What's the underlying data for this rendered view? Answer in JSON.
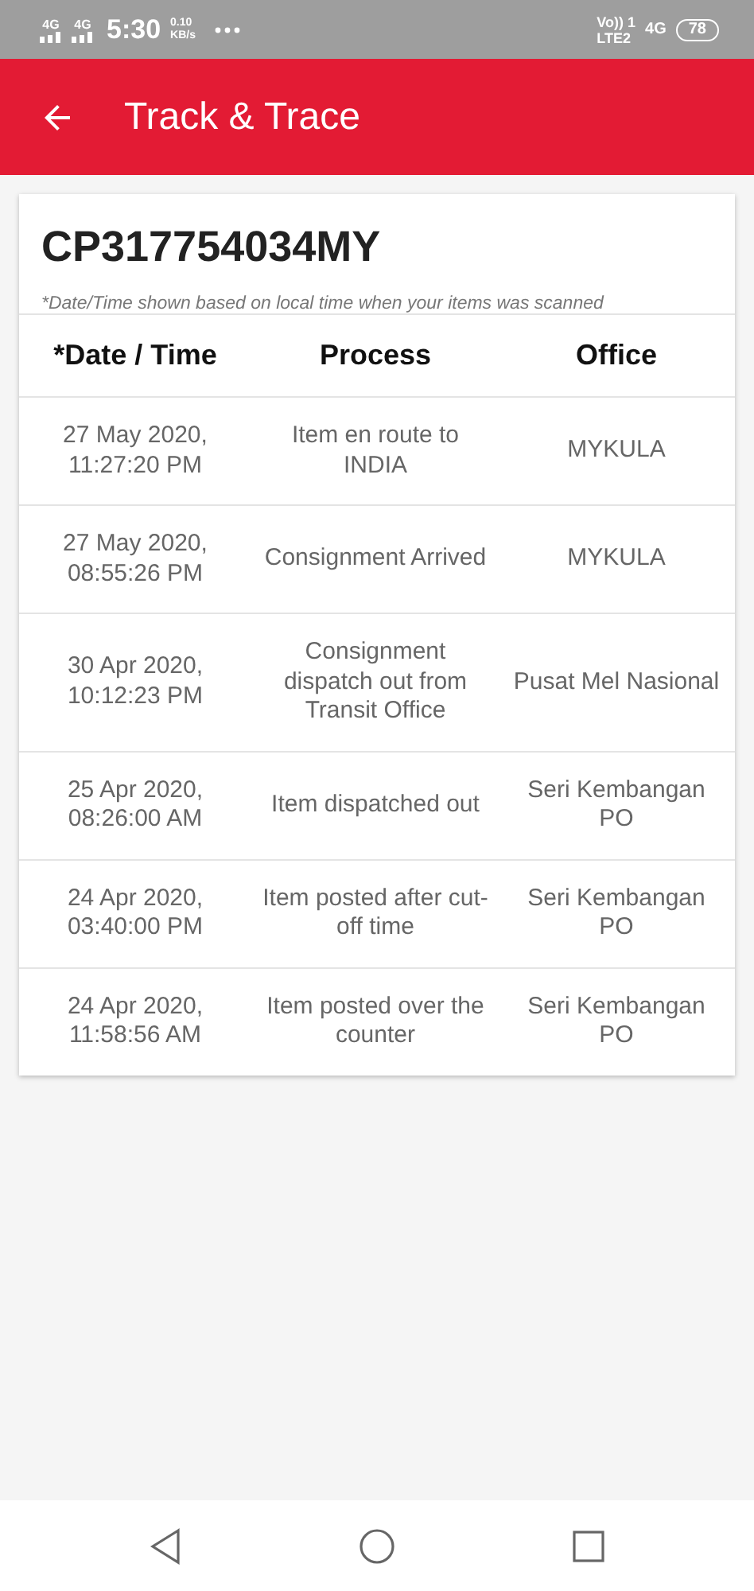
{
  "status_bar": {
    "left": [
      "4G",
      "4G"
    ],
    "time": "5:30",
    "speed": [
      "0.10",
      "KB/s"
    ],
    "right": {
      "volte": "Vo))",
      "sim": "1",
      "lte": "LTE2",
      "network": "4G",
      "battery": "78"
    }
  },
  "app_bar": {
    "title": "Track & Trace"
  },
  "tracking_number": "CP317754034MY",
  "note": "*Date/Time shown based on local time when your items was scanned",
  "table": {
    "columns": [
      "*Date / Time",
      "Process",
      "Office"
    ],
    "rows": [
      {
        "date": "27 May 2020, 11:27:20 PM",
        "process": "Item en route to INDIA",
        "office": "MYKULA"
      },
      {
        "date": "27 May 2020, 08:55:26 PM",
        "process": "Consignment Arrived",
        "office": "MYKULA"
      },
      {
        "date": "30 Apr 2020, 10:12:23 PM",
        "process": "Consignment dispatch out from Transit Office",
        "office": "Pusat Mel Nasional"
      },
      {
        "date": "25 Apr 2020, 08:26:00 AM",
        "process": "Item dispatched out",
        "office": "Seri Kembangan PO"
      },
      {
        "date": "24 Apr 2020, 03:40:00 PM",
        "process": "Item posted after cut-off time",
        "office": "Seri Kembangan PO"
      },
      {
        "date": "24 Apr 2020, 11:58:56 AM",
        "process": "Item posted over the counter",
        "office": "Seri Kembangan PO"
      }
    ]
  }
}
